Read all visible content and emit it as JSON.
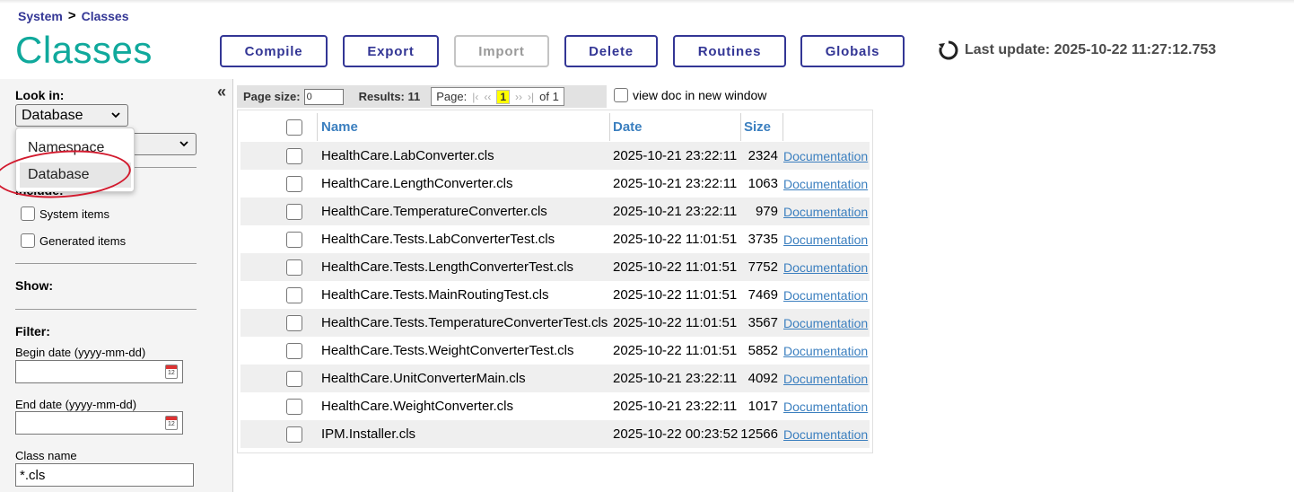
{
  "breadcrumb": {
    "root": "System",
    "separator": ">",
    "current": "Classes"
  },
  "page_title": "Classes",
  "buttons": {
    "compile": "Compile",
    "export": "Export",
    "import": "Import",
    "delete": "Delete",
    "routines": "Routines",
    "globals": "Globals"
  },
  "last_update": "Last update: 2025-10-22 11:27:12.753",
  "sidebar": {
    "look_in_label": "Look in:",
    "look_in_value": "Database",
    "dropdown_options": [
      "Namespace",
      "Database"
    ],
    "include_label": "Include:",
    "system_items": "System items",
    "generated_items": "Generated items",
    "show_label": "Show:",
    "filter_label": "Filter:",
    "begin_date_label": "Begin date (yyyy-mm-dd)",
    "end_date_label": "End date (yyyy-mm-dd)",
    "class_name_label": "Class name",
    "class_name_value": "*.cls",
    "collapse": "«"
  },
  "toolbar": {
    "page_size_label": "Page size:",
    "page_size_value": "0",
    "results": "Results: 11",
    "page_label": "Page:",
    "first": "|‹",
    "prev": "‹‹",
    "current_page": "1",
    "next": "››",
    "last": "›|",
    "of": "of 1",
    "view_doc": "view doc in new window"
  },
  "table": {
    "headers": {
      "name": "Name",
      "date": "Date",
      "size": "Size"
    },
    "doc_label": "Documentation",
    "rows": [
      {
        "name": "HealthCare.LabConverter.cls",
        "date": "2025-10-21 23:22:11",
        "size": "2324"
      },
      {
        "name": "HealthCare.LengthConverter.cls",
        "date": "2025-10-21 23:22:11",
        "size": "1063"
      },
      {
        "name": "HealthCare.TemperatureConverter.cls",
        "date": "2025-10-21 23:22:11",
        "size": "979"
      },
      {
        "name": "HealthCare.Tests.LabConverterTest.cls",
        "date": "2025-10-22 11:01:51",
        "size": "3735"
      },
      {
        "name": "HealthCare.Tests.LengthConverterTest.cls",
        "date": "2025-10-22 11:01:51",
        "size": "7752"
      },
      {
        "name": "HealthCare.Tests.MainRoutingTest.cls",
        "date": "2025-10-22 11:01:51",
        "size": "7469"
      },
      {
        "name": "HealthCare.Tests.TemperatureConverterTest.cls",
        "date": "2025-10-22 11:01:51",
        "size": "3567"
      },
      {
        "name": "HealthCare.Tests.WeightConverterTest.cls",
        "date": "2025-10-22 11:01:51",
        "size": "5852"
      },
      {
        "name": "HealthCare.UnitConverterMain.cls",
        "date": "2025-10-21 23:22:11",
        "size": "4092"
      },
      {
        "name": "HealthCare.WeightConverter.cls",
        "date": "2025-10-21 23:22:11",
        "size": "1017"
      },
      {
        "name": "IPM.Installer.cls",
        "date": "2025-10-22 00:23:52",
        "size": "12566"
      }
    ]
  },
  "colors": {
    "title": "#10a99c",
    "brand": "#333695",
    "link": "#3b7fbf",
    "highlight_ellipse": "#d21a2e"
  }
}
